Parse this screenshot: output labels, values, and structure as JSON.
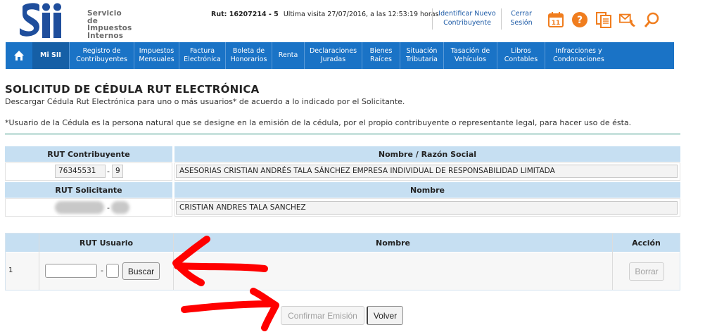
{
  "header": {
    "logo_text": [
      "Servicio",
      "de Impuestos",
      "Internos"
    ],
    "rut_label": "Rut: 16207214 - 5",
    "last_visit": "Ultima visita 27/07/2016, a las 12:53:19 horas",
    "identify_link": [
      "Identificar Nuevo",
      "Contribuyente"
    ],
    "logout_link": [
      "Cerrar",
      "Sesión"
    ],
    "calendar_day": "11",
    "icons": [
      "calendar-icon",
      "help-icon",
      "documents-icon",
      "mail-phone-icon",
      "search-icon"
    ]
  },
  "nav": {
    "items": [
      [
        "Mi SII"
      ],
      [
        "Registro de",
        "Contribuyentes"
      ],
      [
        "Impuestos",
        "Mensuales"
      ],
      [
        "Factura",
        "Electrónica"
      ],
      [
        "Boleta de",
        "Honorarios"
      ],
      [
        "Renta"
      ],
      [
        "Declaraciones",
        "Juradas"
      ],
      [
        "Bienes",
        "Raíces"
      ],
      [
        "Situación",
        "Tributaria"
      ],
      [
        "Tasación de",
        "Vehículos"
      ],
      [
        "Libros",
        "Contables"
      ],
      [
        "Infracciones y",
        "Condonaciones"
      ]
    ]
  },
  "page": {
    "title": "SOLICITUD DE CÉDULA RUT ELECTRÓNICA",
    "subtitle": "Descargar Cédula Rut Electrónica para uno o más usuarios* de acuerdo a lo indicado por el Solicitante.",
    "note": "*Usuario de la Cédula es la persona natural que se designe en la emisión de la cédula, por el propio contribuyente o representante legal, para hacer uso de ésta."
  },
  "taxpayer": {
    "rut_header": "RUT Contribuyente",
    "name_header": "Nombre / Razón Social",
    "rut": "76345531",
    "dv": "9",
    "name": "ASESORIAS CRISTIAN ANDRÉS TALA SÁNCHEZ  EMPRESA INDIVIDUAL DE RESPONSABILIDAD LIMITADA"
  },
  "applicant": {
    "rut_header": "RUT Solicitante",
    "name_header": "Nombre",
    "dash": "-",
    "name": "CRISTIAN ANDRES TALA SANCHEZ"
  },
  "users": {
    "headers": [
      "RUT Usuario",
      "Nombre",
      "Acción"
    ],
    "row_number": "1",
    "rut_value": "",
    "dv_value": "",
    "dash": "-",
    "search_button": "Buscar",
    "delete_button": "Borrar"
  },
  "actions": {
    "confirm_button": "Confirmar Emisión",
    "back_button": "Volver"
  },
  "colors": {
    "brand_blue": "#1a73c6",
    "table_header": "#c6dff2",
    "annotation_red": "#ff0000",
    "icon_orange": "#f07d1e"
  }
}
